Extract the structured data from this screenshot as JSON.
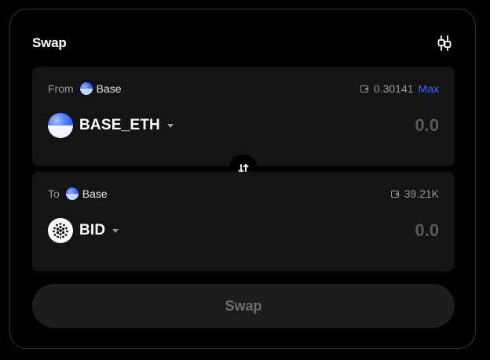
{
  "header": {
    "title": "Swap",
    "settings_icon": "sliders-icon"
  },
  "from": {
    "direction_label": "From",
    "chain_name": "Base",
    "balance": "0.30141",
    "max_label": "Max",
    "token_symbol": "BASE_ETH",
    "amount_placeholder": "0.0"
  },
  "to": {
    "direction_label": "To",
    "chain_name": "Base",
    "balance": "39.21K",
    "token_symbol": "BID",
    "amount_placeholder": "0.0"
  },
  "switch": {
    "icon": "swap-vertical-arrows-icon"
  },
  "action": {
    "swap_label": "Swap"
  },
  "colors": {
    "background": "#000000",
    "panel": "#141414",
    "accent_link": "#3a6bff",
    "chain_blue": "#3d6bff",
    "muted_text": "#9a9a9a",
    "disabled_button": "#1d1d1d"
  }
}
